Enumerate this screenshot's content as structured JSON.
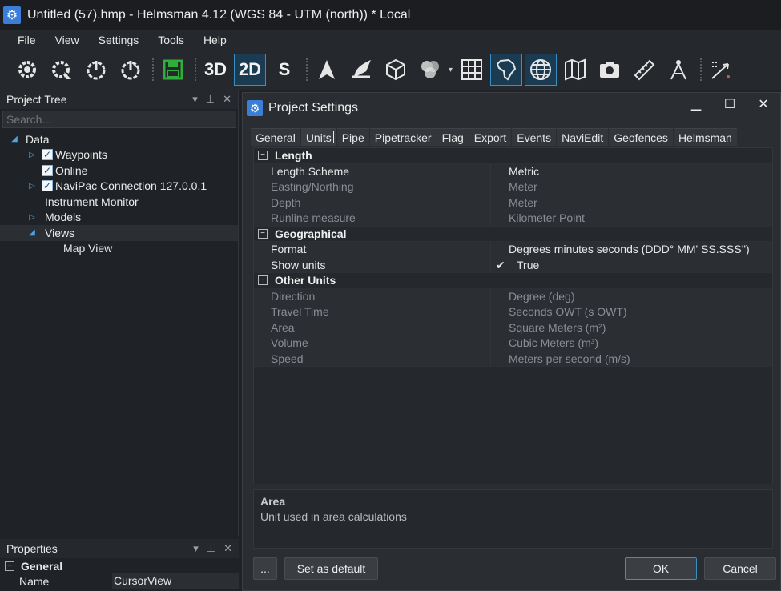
{
  "window": {
    "title": "Untitled (57).hmp - Helmsman 4.12 (WGS 84 - UTM (north)) * Local"
  },
  "menu": [
    "File",
    "View",
    "Settings",
    "Tools",
    "Help"
  ],
  "toolbar": {
    "btn_3d": "3D",
    "btn_2d": "2D",
    "btn_s": "S"
  },
  "project_tree": {
    "title": "Project Tree",
    "search_placeholder": "Search...",
    "items": [
      {
        "label": "Data"
      },
      {
        "label": "Waypoints"
      },
      {
        "label": "Online"
      },
      {
        "label": "NaviPac Connection 127.0.0.1"
      },
      {
        "label": "Instrument Monitor"
      },
      {
        "label": "Models"
      },
      {
        "label": "Views"
      },
      {
        "label": "Map View"
      }
    ]
  },
  "properties": {
    "title": "Properties",
    "group": "General",
    "rows": [
      {
        "key": "Name",
        "value": "CursorView"
      }
    ]
  },
  "dialog": {
    "title": "Project Settings",
    "tabs": [
      "General",
      "Units",
      "Pipe",
      "Pipetracker",
      "Flag",
      "Export",
      "Events",
      "NaviEdit",
      "Geofences",
      "Helmsman"
    ],
    "active_tab": "Units",
    "categories": [
      {
        "name": "Length",
        "rows": [
          {
            "key": "Length Scheme",
            "value": "Metric"
          },
          {
            "key": "Easting/Northing",
            "value": "Meter"
          },
          {
            "key": "Depth",
            "value": "Meter"
          },
          {
            "key": "Runline measure",
            "value": "Kilometer Point"
          }
        ]
      },
      {
        "name": "Geographical",
        "rows": [
          {
            "key": "Format",
            "value": "Degrees minutes seconds (DDD° MM' SS.SSS'')"
          },
          {
            "key": "Show units",
            "value": "True"
          }
        ]
      },
      {
        "name": "Other Units",
        "rows": [
          {
            "key": "Direction",
            "value": "Degree (deg)"
          },
          {
            "key": "Travel Time",
            "value": "Seconds OWT (s OWT)"
          },
          {
            "key": "Area",
            "value": "Square Meters (m²)"
          },
          {
            "key": "Volume",
            "value": "Cubic Meters (m³)"
          },
          {
            "key": "Speed",
            "value": "Meters per second (m/s)"
          }
        ]
      }
    ],
    "description": {
      "title": "Area",
      "text": "Unit used in area calculations"
    },
    "buttons": {
      "more": "...",
      "set_default": "Set as default",
      "ok": "OK",
      "cancel": "Cancel"
    }
  }
}
